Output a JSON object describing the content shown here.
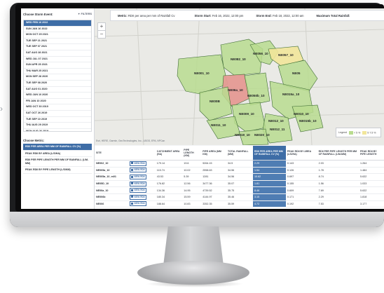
{
  "storm_panel": {
    "title": "Choose Storm Event:",
    "filters_label": "FILTERS",
    "events": [
      "WED FEB 16 2022",
      "SUN JAN 16 2022",
      "MON OCT 25 2021",
      "TUE SEP 21 2021",
      "TUE SEP 07 2021",
      "SAT AUG 28 2021",
      "WED JUL 07 2021",
      "SUN APR 25 2021",
      "THU MAR 25 2021",
      "MON SEP 28 2020",
      "TUE SEP 08 2020",
      "SAT AUG 01 2020",
      "WED JUN 10 2020",
      "FRI JAN 10 2020",
      "WED OCT 30 2019",
      "SAT OCT 26 2019",
      "TUE SEP 10 2019",
      "THU AUG 29 2019",
      "MON AUG 26 2019",
      "WED AUG 07 2019",
      "TUE JUL 23 2019"
    ]
  },
  "metric_panel": {
    "title": "Choose Metric:",
    "metrics": [
      "RDII PER AREA PER MM OF RAINFALL CV (%)",
      "PEAK RDII BY AREA (L/S/HA)",
      "RDII PER PIPE LENGTH PER MM OF RAINFALL (L/M-MM)",
      "PEAK RDII BY PIPE LENGTH (L/S/KM)"
    ]
  },
  "toolbar": {
    "metric_label": "Metric:",
    "metric_value": "RDII per area per mm of Rainfall Cv",
    "storm_start_label": "Storm Start:",
    "storm_start_value": "Feb 16, 2022, 12:00 pm",
    "storm_end_label": "Storm End:",
    "storm_end_value": "Feb 18, 2022, 12:00 am",
    "max_rain_label": "Maximum Total Rainfall:"
  },
  "map": {
    "zoom_in": "+",
    "zoom_out": "−",
    "attribution": "Esri, HERE, Garmin, GeoTechnologies, Inc., USGS, EPA, NPCan",
    "legend_label": "Legend",
    "legend_items": [
      "< 5 %",
      "5 7.5 %"
    ],
    "legend_colors": [
      "#b9dc8f",
      "#f2e69a"
    ],
    "regions": [
      "NE082_10",
      "NE056_10",
      "NE057_10",
      "NE001_10",
      "NE05",
      "NE06a_10",
      "NE050b_10",
      "NE015a_10",
      "NE00B",
      "NE009_10",
      "NE010_10",
      "NE012_10",
      "NE015b_10",
      "NE011_10",
      "NE012_11",
      "NE019_10",
      "NE020_10"
    ]
  },
  "table": {
    "columns": [
      "SITE",
      "",
      "CATCHMENT AREA (HA)",
      "PIPE LENGTH (KM)",
      "PIPE AREA (MM KM)",
      "TOTAL RAINFALL (MM)",
      "RDII PER AREA PER MM OF RAINFALL CV (%)",
      "PEAK RDII BY AREA (L/S/HA)",
      "RDII PER PIPE LENGTH PER MM OF RAINFALL (L/M-MM)",
      "PEAK RDII BY PIPE LENGTH"
    ],
    "button_label": "VIEW RDII",
    "rows": [
      [
        "NE002_10",
        "179.14",
        "19.6",
        "5264.15",
        "34.5",
        "2.29",
        "0.143",
        "2.03",
        "1.264"
      ],
      [
        "NE005a_10",
        "115.74",
        "10.02",
        "2558.63",
        "34.56",
        "1.54",
        "0.126",
        "1.78",
        "1.484"
      ],
      [
        "NE005a_10_m01",
        "43.53",
        "5.39",
        "1281",
        "34.56",
        "10.62",
        "0.697",
        "8.74",
        "5.632"
      ],
      [
        "NE05D_10",
        "176.82",
        "12.56",
        "3477.36",
        "35.07",
        "1.81",
        "0.155",
        "1.56",
        "1.033"
      ],
      [
        "NE06a_10",
        "134.36",
        "14.95",
        "4739.52",
        "35.75",
        "8.46",
        "0.609",
        "7.69",
        "5.632"
      ],
      [
        "NE006b",
        "180.34",
        "15.59",
        "4144.97",
        "35.46",
        "3.15",
        "0.171",
        "2.29",
        "1.818"
      ],
      [
        "NE006",
        "188.64",
        "10.83",
        "3352.35",
        "35.59",
        "4.72",
        "0.192",
        "7.53",
        "3.177"
      ]
    ]
  }
}
